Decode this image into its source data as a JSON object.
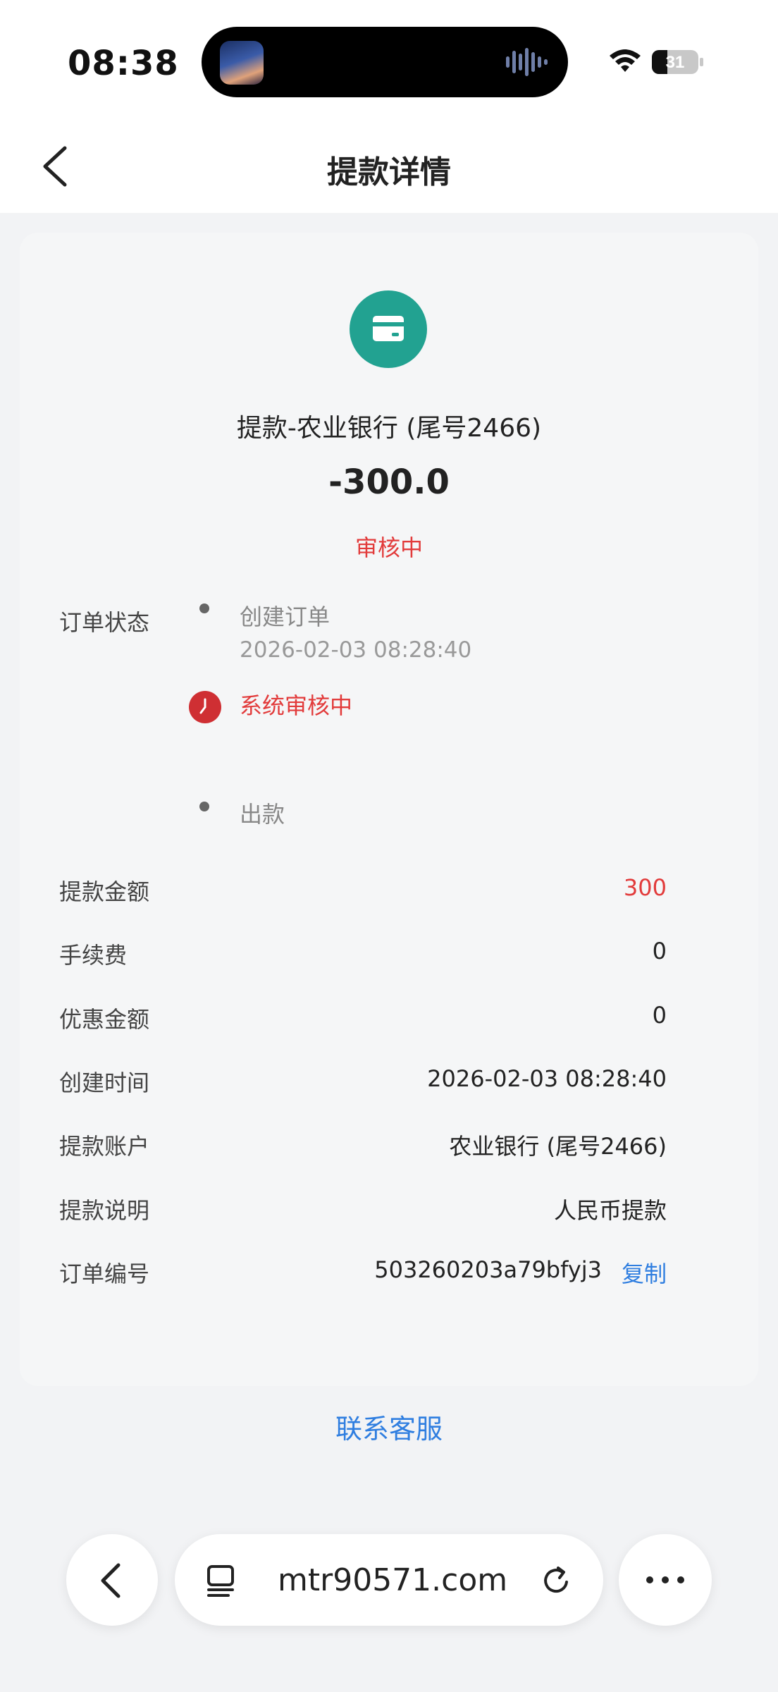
{
  "status_bar": {
    "time": "08:38",
    "battery": "31"
  },
  "header": {
    "title": "提款详情"
  },
  "withdrawal": {
    "title": "提款-农业银行 (尾号2466)",
    "amount": "-300.0",
    "status": "审核中"
  },
  "timeline": {
    "label": "订单状态",
    "steps": [
      {
        "text": "创建订单",
        "time": "2026-02-03 08:28:40"
      },
      {
        "text": "系统审核中"
      },
      {
        "text": "出款"
      }
    ]
  },
  "details": [
    {
      "label": "提款金额",
      "value": "300"
    },
    {
      "label": "手续费",
      "value": "0"
    },
    {
      "label": "优惠金额",
      "value": "0"
    },
    {
      "label": "创建时间",
      "value": "2026-02-03 08:28:40"
    },
    {
      "label": "提款账户",
      "value": "农业银行 (尾号2466)"
    },
    {
      "label": "提款说明",
      "value": "人民币提款"
    },
    {
      "label": "订单编号",
      "value": "503260203a79bfyj3"
    }
  ],
  "copy_label": "复制",
  "contact_label": "联系客服",
  "browser": {
    "url": "mtr90571.com"
  },
  "colors": {
    "accent_green": "#22a291",
    "status_red": "#e23b3b",
    "link_blue": "#2f7ee0"
  }
}
